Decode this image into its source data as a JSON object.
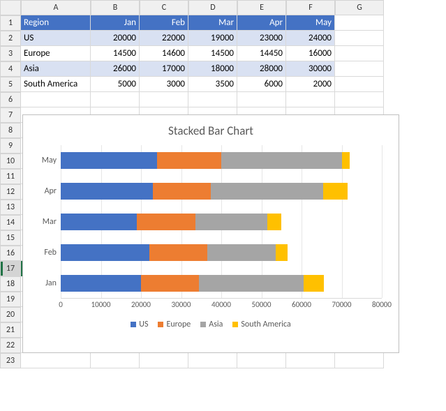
{
  "columns": [
    "A",
    "B",
    "C",
    "D",
    "E",
    "F",
    "G"
  ],
  "row_count": 23,
  "selected_row": 17,
  "selected_cell": {
    "row": 17,
    "col": 0
  },
  "table": {
    "header": [
      "Region",
      "Jan",
      "Feb",
      "Mar",
      "Apr",
      "May"
    ],
    "rows": [
      {
        "region": "US",
        "values": [
          20000,
          22000,
          19000,
          23000,
          24000
        ],
        "band": true
      },
      {
        "region": "Europe",
        "values": [
          14500,
          14600,
          14500,
          14450,
          16000
        ],
        "band": false
      },
      {
        "region": "Asia",
        "values": [
          26000,
          17000,
          18000,
          28000,
          30000
        ],
        "band": true
      },
      {
        "region": "South America",
        "values": [
          5000,
          3000,
          3500,
          6000,
          2000
        ],
        "band": false
      }
    ]
  },
  "chart_data": {
    "type": "bar",
    "orientation": "horizontal",
    "stacked": true,
    "title": "Stacked Bar Chart",
    "xlabel": "",
    "ylabel": "",
    "xlim": [
      0,
      80000
    ],
    "xticks": [
      0,
      10000,
      20000,
      30000,
      40000,
      50000,
      60000,
      70000,
      80000
    ],
    "categories": [
      "Jan",
      "Feb",
      "Mar",
      "Apr",
      "May"
    ],
    "display_order": [
      "May",
      "Apr",
      "Mar",
      "Feb",
      "Jan"
    ],
    "series": [
      {
        "name": "US",
        "color": "#4472c4",
        "values": [
          20000,
          22000,
          19000,
          23000,
          24000
        ]
      },
      {
        "name": "Europe",
        "color": "#ed7d31",
        "values": [
          14500,
          14600,
          14500,
          14450,
          16000
        ]
      },
      {
        "name": "Asia",
        "color": "#a5a5a5",
        "values": [
          26000,
          17000,
          18000,
          28000,
          30000
        ]
      },
      {
        "name": "South America",
        "color": "#ffc000",
        "values": [
          5000,
          3000,
          3500,
          6000,
          2000
        ]
      }
    ],
    "legend_position": "bottom",
    "grid": true
  }
}
